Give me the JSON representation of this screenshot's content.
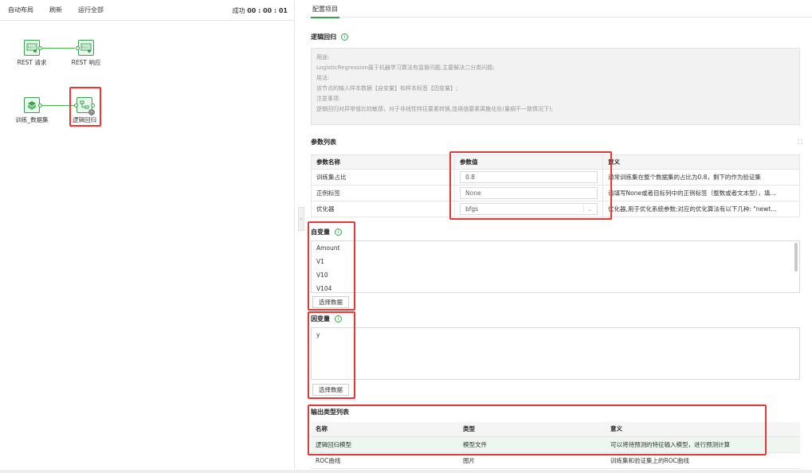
{
  "toolbar": {
    "auto_layout": "自动布局",
    "refresh": "刷新",
    "run_all": "运行全部",
    "status_prefix": "成功",
    "status_time": "00 : 00 : 01"
  },
  "canvas": {
    "nodes": {
      "rest_request": {
        "label": "REST 请求",
        "icon": "rest-icon"
      },
      "rest_response": {
        "label": "REST 响应",
        "icon": "rest-icon"
      },
      "train_dataset": {
        "label": "训练_数据集",
        "icon": "layers-icon"
      },
      "logistic": {
        "label": "逻辑回归",
        "icon": "flow-icon"
      }
    },
    "collapse": "‹"
  },
  "panel": {
    "tab": "配置项目",
    "title": "逻辑回归",
    "description": [
      "用途:",
      "LogisticRegression属于机器学习算法有监督问题,主要解决二分类问题;",
      "用法:",
      "该节点的输入样本数据【自变量】和样本标签【因变量】;",
      "注意事项:",
      "逻辑回归对异常值比较敏感，对于非线性特征要素转换,连续值要素离散化处(量纲不一致情况下);"
    ],
    "params": {
      "title": "参数列表",
      "headers": [
        "参数名称",
        "参数值",
        "意义"
      ],
      "rows": [
        {
          "name": "训练集占比",
          "value": "0.8",
          "meaning": "通常训练集在整个数据集的占比为0.8，剩下的作为验证集"
        },
        {
          "name": "正例标签",
          "value": "None",
          "meaning": "请填写None或者目标列中的正例标签（整数或者文本型），填…"
        },
        {
          "name": "优化器",
          "value": "bfgs",
          "meaning": "优化器,用于优化系统参数;对应的优化算法有以下几种: \"newt…"
        }
      ]
    },
    "independent": {
      "title": "自变量",
      "items": [
        "Amount",
        "V1",
        "V10",
        "V104"
      ],
      "button": "选择数据"
    },
    "dependent": {
      "title": "因变量",
      "items": [
        "y"
      ],
      "button": "选择数据"
    },
    "outputs": {
      "title": "输出类型列表",
      "headers": [
        "名称",
        "类型",
        "意义"
      ],
      "rows": [
        {
          "name": "逻辑回归模型",
          "type": "模型文件",
          "meaning": "可以将待预测的特征输入模型，进行预测计算"
        },
        {
          "name": "ROC曲线",
          "type": "图片",
          "meaning": "训练集和验证集上的ROC曲线"
        }
      ]
    },
    "colors": {
      "accent": "#3aa14f",
      "highlight": "#e53935"
    }
  }
}
